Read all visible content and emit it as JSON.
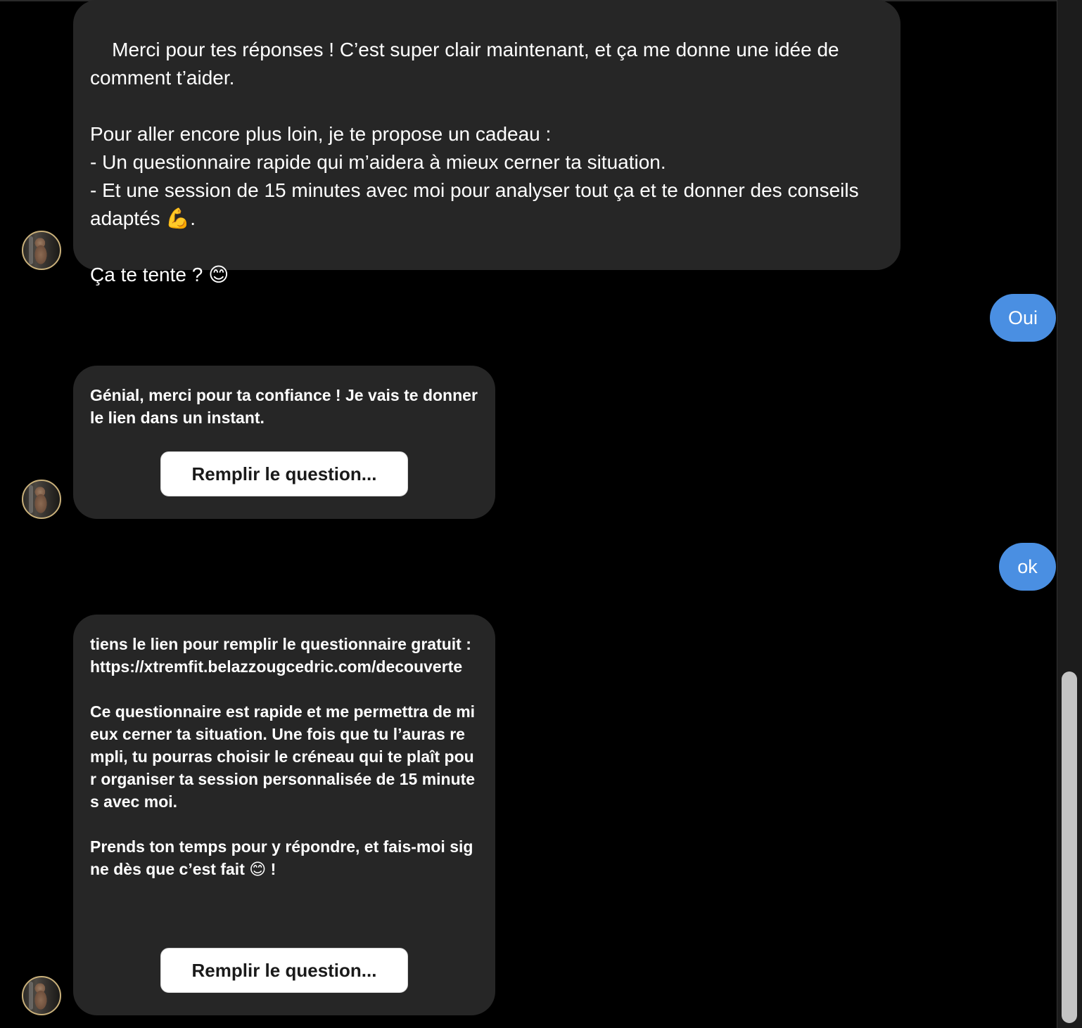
{
  "conversation": {
    "messages": [
      {
        "sender": "bot",
        "text": "Merci pour tes réponses ! C’est super clair maintenant, et ça me donne une idée de comment t’aider.\n\nPour aller encore plus loin, je te propose un cadeau :\n- Un questionnaire rapide qui m’aidera à mieux cerner ta situation.\n- Et une session de 15 minutes avec moi pour analyser tout ça et te donner des conseils adaptés 💪.\n\nÇa te tente ? 😊"
      },
      {
        "sender": "user",
        "text": "Oui"
      },
      {
        "sender": "bot",
        "text": "Génial, merci pour ta confiance ! Je vais te donner le lien dans un instant.",
        "button_label": "Remplir le question..."
      },
      {
        "sender": "user",
        "text": "ok"
      },
      {
        "sender": "bot",
        "text": "tiens le lien pour remplir le questionnaire gratuit : https://xtremfit.belazzougcedric.com/decouverte\n\nCe questionnaire est rapide et me permettra de mieux cerner ta situation. Une fois que tu l’auras rempli, tu pourras choisir le créneau qui te plaît pour organiser ta session personnalisée de 15 minutes avec moi.\n\nPrends ton temps pour y répondre, et fais-moi signe dès que c’est fait 😊 !",
        "button_label": "Remplir le question..."
      }
    ]
  },
  "colors": {
    "background": "#000000",
    "bot_bubble": "#262626",
    "user_bubble": "#4a8fe2",
    "button_bg": "#ffffff",
    "avatar_ring": "#c9b07a"
  },
  "icons": {
    "avatar": "profile-photo-avatar",
    "scroll": "vertical-scrollbar"
  }
}
